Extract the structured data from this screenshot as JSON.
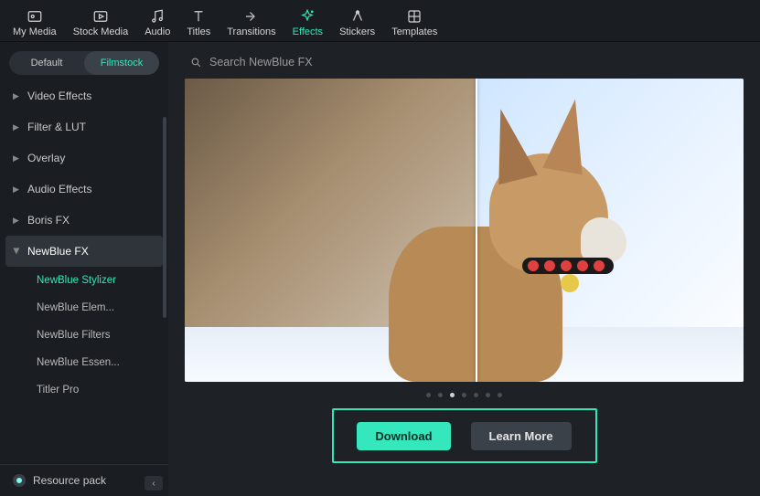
{
  "toolbar": {
    "items": [
      {
        "label": "My Media",
        "icon": "media-icon"
      },
      {
        "label": "Stock Media",
        "icon": "stock-icon"
      },
      {
        "label": "Audio",
        "icon": "audio-icon"
      },
      {
        "label": "Titles",
        "icon": "titles-icon"
      },
      {
        "label": "Transitions",
        "icon": "transitions-icon"
      },
      {
        "label": "Effects",
        "icon": "effects-icon",
        "active": true
      },
      {
        "label": "Stickers",
        "icon": "stickers-icon"
      },
      {
        "label": "Templates",
        "icon": "templates-icon"
      }
    ]
  },
  "sidebar": {
    "tabs": {
      "default": "Default",
      "filmstock": "Filmstock",
      "active": "filmstock"
    },
    "categories": [
      {
        "label": "Video Effects"
      },
      {
        "label": "Filter & LUT"
      },
      {
        "label": "Overlay"
      },
      {
        "label": "Audio Effects"
      },
      {
        "label": "Boris FX"
      },
      {
        "label": "NewBlue FX",
        "expanded": true,
        "children": [
          {
            "label": "NewBlue Stylizer",
            "active": true
          },
          {
            "label": "NewBlue Elem..."
          },
          {
            "label": "NewBlue Filters"
          },
          {
            "label": "NewBlue Essen..."
          },
          {
            "label": "Titler Pro"
          }
        ]
      }
    ],
    "resource_pack": "Resource pack"
  },
  "search": {
    "placeholder": "Search NewBlue FX"
  },
  "preview": {
    "description": "Before/after comparison of a corgi dog in snow with NewBlue Stylizer effect applied",
    "pager": {
      "count": 7,
      "active_index": 2
    }
  },
  "actions": {
    "download": "Download",
    "learn_more": "Learn More"
  }
}
